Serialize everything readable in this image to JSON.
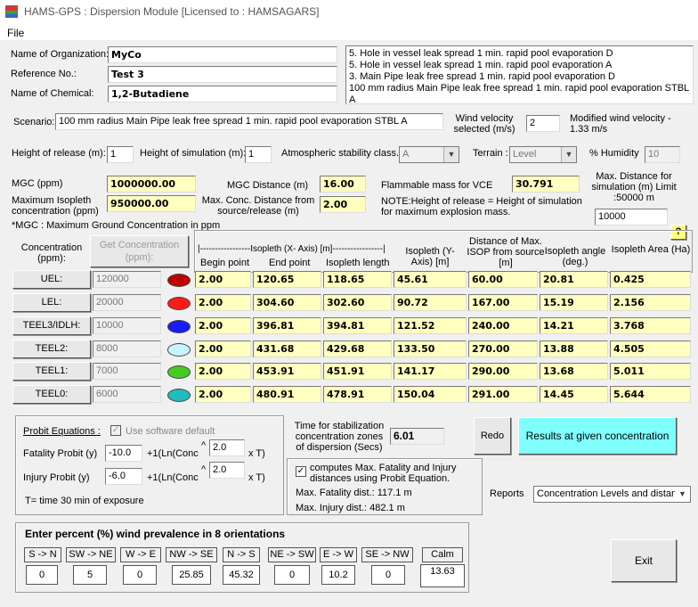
{
  "window": {
    "title": "HAMS-GPS : Dispersion Module  [Licensed to : HAMSAGARS]"
  },
  "menu": {
    "file": "File"
  },
  "org": {
    "name_label": "Name of Organization:",
    "name_value": "MyCo",
    "ref_label": "Reference No.:",
    "ref_value": "Test 3",
    "chem_label": "Name of Chemical:",
    "chem_value": "1,2-Butadiene"
  },
  "scenario_list": [
    "5. Hole in vessel leak spread 1 min. rapid pool evaporation D",
    "5. Hole in vessel leak spread 1 min. rapid pool evaporation A",
    "3. Main Pipe leak free spread 1 min. rapid pool evaporation  D",
    "100 mm radius Main Pipe leak free spread 1 min. rapid pool evaporation  STBL A"
  ],
  "scenario": {
    "label": "Scenario:",
    "value": "100 mm radius Main Pipe leak free spread 1 min. rapid pool evaporation  STBL A",
    "wind_label": "Wind velocity selected (m/s)",
    "wind_value": "2",
    "mod_wind_label": "Modified wind velocity - 1.33 m/s"
  },
  "params": {
    "height_release_label": "Height of release (m):",
    "height_release_value": "1",
    "height_sim_label": "Height of simulation (m):",
    "height_sim_value": "1",
    "stability_label": "Atmospheric stability class.:",
    "stability_value": "A",
    "terrain_label": "Terrain :",
    "terrain_value": "Level",
    "humidity_label": "% Humidity",
    "humidity_value": "10"
  },
  "results": {
    "mgc_label": "MGC (ppm)",
    "mgc_value": "1000000.00",
    "mgc_dist_label": "MGC Distance (m)",
    "mgc_dist_value": "16.00",
    "flam_label": "Flammable mass for VCE",
    "flam_value": "30.791",
    "max_dist_label": "Max. Distance for simulation (m) Limit :50000 m",
    "max_dist_value": "10000",
    "max_iso_label": "Maximum Isopleth concentration (ppm)",
    "max_iso_value": "950000.00",
    "max_conc_dist_label": "Max. Conc. Distance from source/release (m)",
    "max_conc_dist_value": "2.00",
    "note": "NOTE:Height of release  = Height of simulation for maximum explosion mass.",
    "mgc_footnote": "*MGC :  Maximum Ground Concentration in ppm",
    "help": "?"
  },
  "table": {
    "conc_label": "Concentration (ppm):",
    "get_conc_button": "Get Concentration (ppm):",
    "headers": {
      "isopleth_x": "|-----------------Isopleth (X- Axis) [m]-----------------|",
      "begin": "Begin point",
      "end": "End point",
      "length": "Isopleth length",
      "iso_y": "Isopleth (Y- Axis) [m]",
      "dist_max": "Distance of Max. ISOP from source [m]",
      "angle": "Isopleth angle (deg.)",
      "area": "Isopleth Area (Ha)"
    },
    "rows": [
      {
        "label": "UEL:",
        "conc": "120000",
        "color": "#c00000",
        "begin": "2.00",
        "end": "120.65",
        "length": "118.65",
        "y": "45.61",
        "dist": "60.00",
        "angle": "20.81",
        "area": "0.425"
      },
      {
        "label": "LEL:",
        "conc": "20000",
        "color": "#ff1a1a",
        "begin": "2.00",
        "end": "304.60",
        "length": "302.60",
        "y": "90.72",
        "dist": "167.00",
        "angle": "15.19",
        "area": "2.156"
      },
      {
        "label": "TEEL3/IDLH:",
        "conc": "10000",
        "color": "#1a1aff",
        "begin": "2.00",
        "end": "396.81",
        "length": "394.81",
        "y": "121.52",
        "dist": "240.00",
        "angle": "14.21",
        "area": "3.768"
      },
      {
        "label": "TEEL2:",
        "conc": "8000",
        "color": "#c8f4ff",
        "begin": "2.00",
        "end": "431.68",
        "length": "429.68",
        "y": "133.50",
        "dist": "270.00",
        "angle": "13.88",
        "area": "4.505"
      },
      {
        "label": "TEEL1:",
        "conc": "7000",
        "color": "#44cc22",
        "begin": "2.00",
        "end": "453.91",
        "length": "451.91",
        "y": "141.17",
        "dist": "290.00",
        "angle": "13.68",
        "area": "5.011"
      },
      {
        "label": "TEEL0:",
        "conc": "6000",
        "color": "#22bbbb",
        "begin": "2.00",
        "end": "480.91",
        "length": "478.91",
        "y": "150.04",
        "dist": "291.00",
        "angle": "14.45",
        "area": "5.644"
      }
    ]
  },
  "probit": {
    "title": "Probit Equations :",
    "use_default": "Use software default",
    "fatality_label": "Fatality Probit (y)",
    "fatality_a": "-10.0",
    "fatality_b": "2.0",
    "injury_label": "Injury Probit (y)",
    "injury_a": "-6.0",
    "injury_b": "2.0",
    "ln_text": "+1(Ln(Conc",
    "caret": "^",
    "xt": "x T)",
    "t_note": "T= time 30 min of exposure"
  },
  "stabilization": {
    "label": "Time for stabilization concentration zones of dispersion (Secs)",
    "value": "6.01"
  },
  "compute": {
    "check_label": "computes Max. Fatality and Injury distances using Probit Equation.",
    "fatality": "Max. Fatality dist.: 117.1 m",
    "injury": "Max. Injury dist.: 482.1 m"
  },
  "buttons": {
    "redo": "Redo",
    "results": "Results at given concentration",
    "exit": "Exit"
  },
  "reports": {
    "label": "Reports",
    "value": "Concentration Levels and distance"
  },
  "wind": {
    "title": "Enter percent (%) wind prevalence in 8 orientations",
    "dirs": [
      {
        "label": "S -> N",
        "value": "0"
      },
      {
        "label": "SW -> NE",
        "value": "5"
      },
      {
        "label": "W -> E",
        "value": "0"
      },
      {
        "label": "NW -> SE",
        "value": "25.85"
      },
      {
        "label": "N -> S",
        "value": "45.32"
      },
      {
        "label": "NE -> SW",
        "value": "0"
      },
      {
        "label": "E -> W",
        "value": "10.2"
      },
      {
        "label": "SE -> NW",
        "value": "0"
      },
      {
        "label": "Calm",
        "value": "13.63"
      }
    ]
  },
  "colors": {
    "result_bg": "#ffffc0",
    "results_button": "#80ffff"
  }
}
